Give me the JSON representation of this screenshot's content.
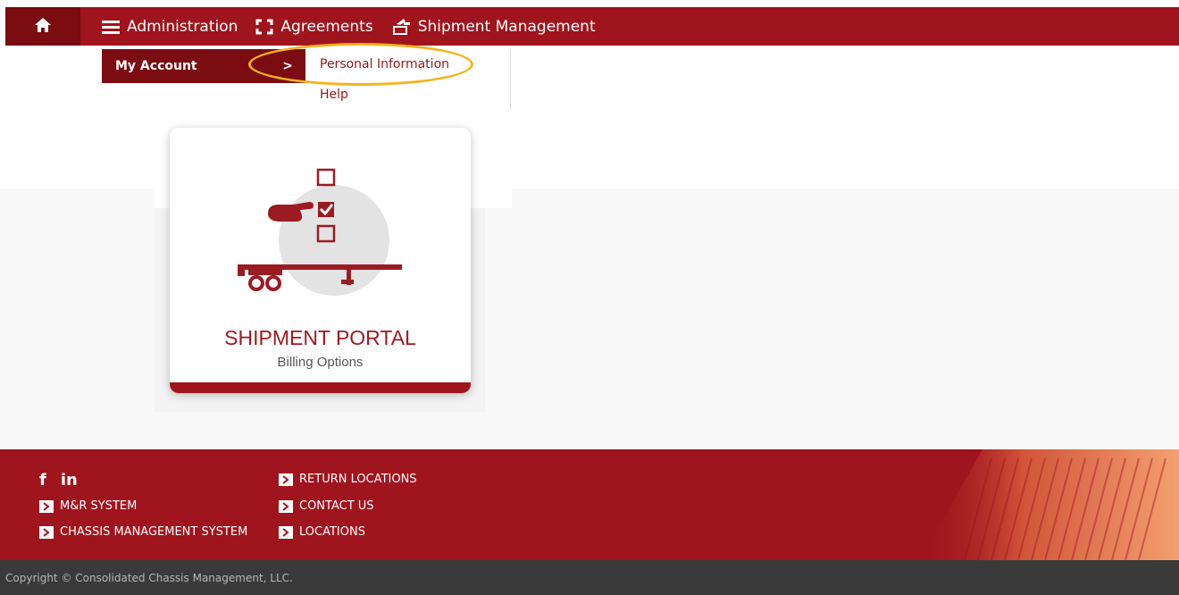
{
  "nav": {
    "home_icon": "home-icon",
    "items": [
      {
        "label": "Administration",
        "icon": "menu-icon"
      },
      {
        "label": "Agreements",
        "icon": "agreements-icon"
      },
      {
        "label": "Shipment Management",
        "icon": "shipment-icon"
      }
    ]
  },
  "dropdown": {
    "parent_label": "My Account",
    "parent_chevron": ">",
    "submenu": [
      "Personal Information",
      "Help"
    ]
  },
  "card": {
    "title": "SHIPMENT PORTAL",
    "subtitle": "Billing Options",
    "illustration_icon": "checklist-chassis-icon"
  },
  "footer": {
    "social": [
      "f",
      "in"
    ],
    "links_left": [
      "M&R SYSTEM",
      "CHASSIS MANAGEMENT SYSTEM"
    ],
    "links_right": [
      "RETURN LOCATIONS",
      "CONTACT US",
      "LOCATIONS"
    ],
    "copyright": "Copyright © Consolidated Chassis Management, LLC."
  },
  "colors": {
    "brand_red": "#a0141d",
    "dark_red": "#7a0c12",
    "highlight": "#f5b21b",
    "footer_dark": "#3a3a3a"
  }
}
